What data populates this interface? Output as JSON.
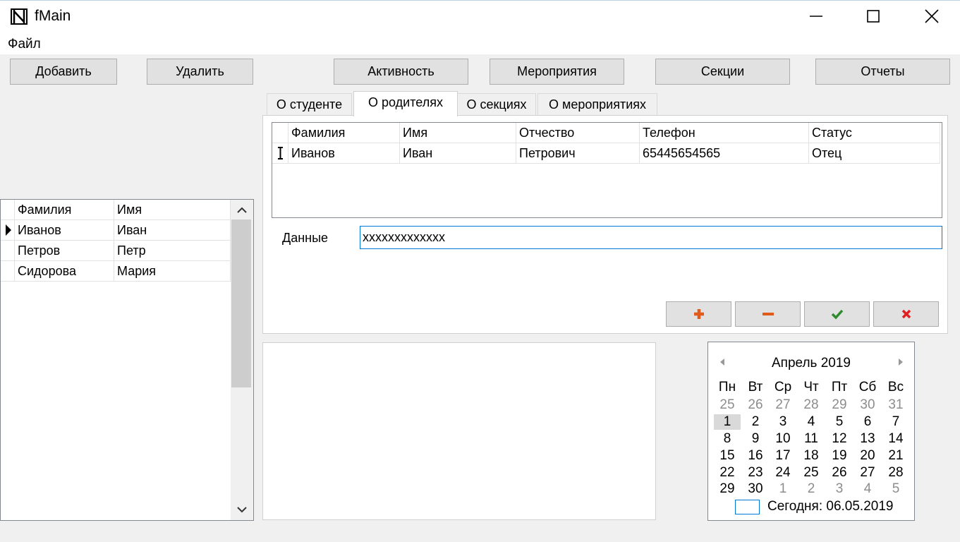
{
  "window": {
    "title": "fMain"
  },
  "menu": {
    "file": "Файл"
  },
  "toolbar": {
    "add": "Добавить",
    "delete": "Удалить",
    "activity": "Активность",
    "events": "Мероприятия",
    "sections": "Секции",
    "reports": "Отчеты"
  },
  "students": {
    "columns": [
      "Фамилия",
      "Имя"
    ],
    "rows": [
      [
        "Иванов",
        "Иван"
      ],
      [
        "Петров",
        "Петр"
      ],
      [
        "Сидорова",
        "Мария"
      ]
    ]
  },
  "tabs": [
    "О студенте",
    "О родителях",
    "О секциях",
    "О мероприятиях"
  ],
  "active_tab_index": 1,
  "parents": {
    "columns": [
      "Фамилия",
      "Имя",
      "Отчество",
      "Телефон",
      "Статус"
    ],
    "rows": [
      [
        "Иванов",
        "Иван",
        "Петрович",
        "65445654565",
        "Отец"
      ]
    ]
  },
  "data_field": {
    "label": "Данные",
    "value": "xxxxxxxxxxxxx"
  },
  "action_icons": [
    "plus-icon",
    "minus-icon",
    "check-icon",
    "cross-icon"
  ],
  "colors": {
    "plus": "#e05a1c",
    "minus": "#e05a1c",
    "check": "#2e8b2e",
    "cross": "#e02020",
    "focus": "#0078d7"
  },
  "calendar": {
    "month_label": "Апрель 2019",
    "weekdays": [
      "Пн",
      "Вт",
      "Ср",
      "Чт",
      "Пт",
      "Сб",
      "Вс"
    ],
    "weeks": [
      [
        25,
        26,
        27,
        28,
        29,
        30,
        31
      ],
      [
        1,
        2,
        3,
        4,
        5,
        6,
        7
      ],
      [
        8,
        9,
        10,
        11,
        12,
        13,
        14
      ],
      [
        15,
        16,
        17,
        18,
        19,
        20,
        21
      ],
      [
        22,
        23,
        24,
        25,
        26,
        27,
        28
      ],
      [
        29,
        30,
        1,
        2,
        3,
        4,
        5
      ]
    ],
    "selected_day": 1,
    "today_label": "Сегодня: 06.05.2019"
  }
}
